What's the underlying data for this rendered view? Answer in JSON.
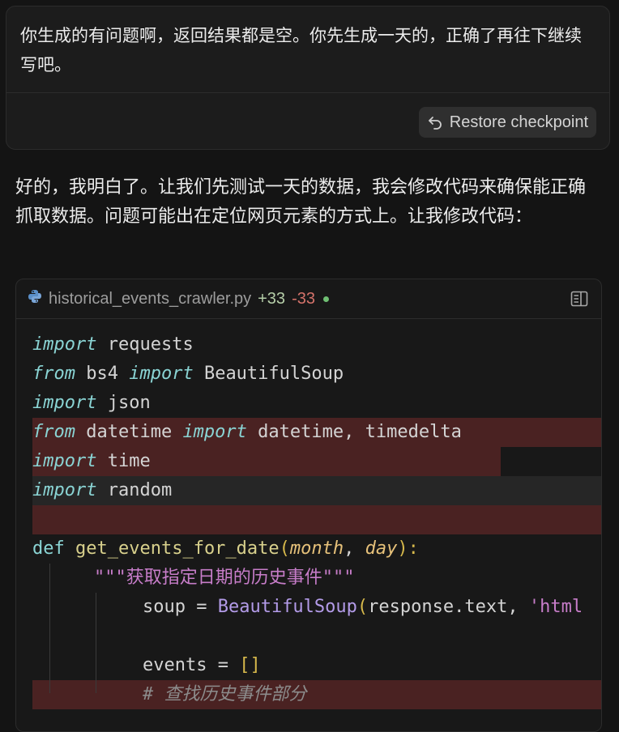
{
  "user_message": {
    "text": "你生成的有问题啊，返回结果都是空。你先生成一天的，正确了再往下继续写吧。",
    "restore_label": "Restore checkpoint"
  },
  "assistant_message": {
    "text": "好的，我明白了。让我们先测试一天的数据，我会修改代码来确保能正确抓取数据。问题可能出在定位网页元素的方式上。让我修改代码："
  },
  "code_block": {
    "filename": "historical_events_crawler.py",
    "added": "+33",
    "removed": "-33",
    "tokens": {
      "import": "import",
      "from": "from",
      "def": "def",
      "requests": " requests",
      "bs4": " bs4 ",
      "BeautifulSoup": " BeautifulSoup",
      "json": " json",
      "datetime_mod": " datetime ",
      "datetime_names": " datetime, timedelta",
      "time": " time",
      "random": " random",
      "func_name": "get_events_for_date",
      "open_paren": "(",
      "month": "month",
      "comma": ", ",
      "day": "day",
      "close_colon": "):",
      "docstring": "\"\"\"获取指定日期的历史事件\"\"\"",
      "soup_assign": "soup = ",
      "bs_class": "BeautifulSoup",
      "bs_open": "(",
      "bs_args": "response.text, ",
      "bs_str": "'html",
      "events_assign": "events = ",
      "events_brackets": "[]",
      "comment": "# 查找历史事件部分"
    }
  }
}
